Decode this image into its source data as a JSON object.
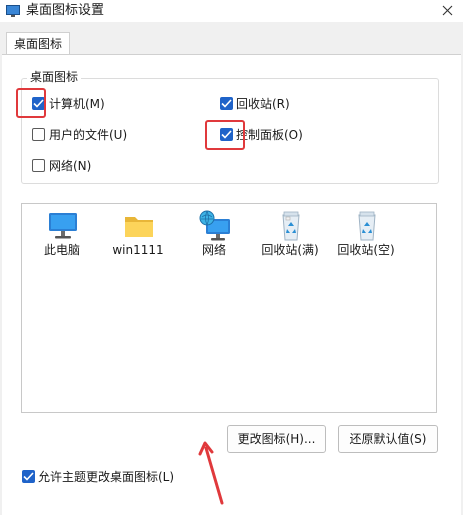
{
  "window": {
    "title": "桌面图标设置",
    "close_label": "✕"
  },
  "tabs": [
    {
      "label": "桌面图标"
    }
  ],
  "group": {
    "legend": "桌面图标",
    "checkboxes": [
      {
        "label": "计算机(M)",
        "checked": true
      },
      {
        "label": "回收站(R)",
        "checked": true
      },
      {
        "label": "用户的文件(U)",
        "checked": false
      },
      {
        "label": "控制面板(O)",
        "checked": true
      },
      {
        "label": "网络(N)",
        "checked": false
      }
    ]
  },
  "icons": [
    {
      "label": "此电脑",
      "icon": "monitor-icon"
    },
    {
      "label": "win1111",
      "icon": "folder-icon"
    },
    {
      "label": "网络",
      "icon": "network-icon"
    },
    {
      "label": "回收站(满)",
      "icon": "recycle-bin-full-icon"
    },
    {
      "label": "回收站(空)",
      "icon": "recycle-bin-empty-icon"
    }
  ],
  "buttons": {
    "change_icon": "更改图标(H)...",
    "restore_default": "还原默认值(S)"
  },
  "allow_themes": {
    "label": "允许主题更改桌面图标(L)",
    "checked": true
  },
  "colors": {
    "accent": "#1f63c9",
    "highlight": "#e0393c"
  }
}
